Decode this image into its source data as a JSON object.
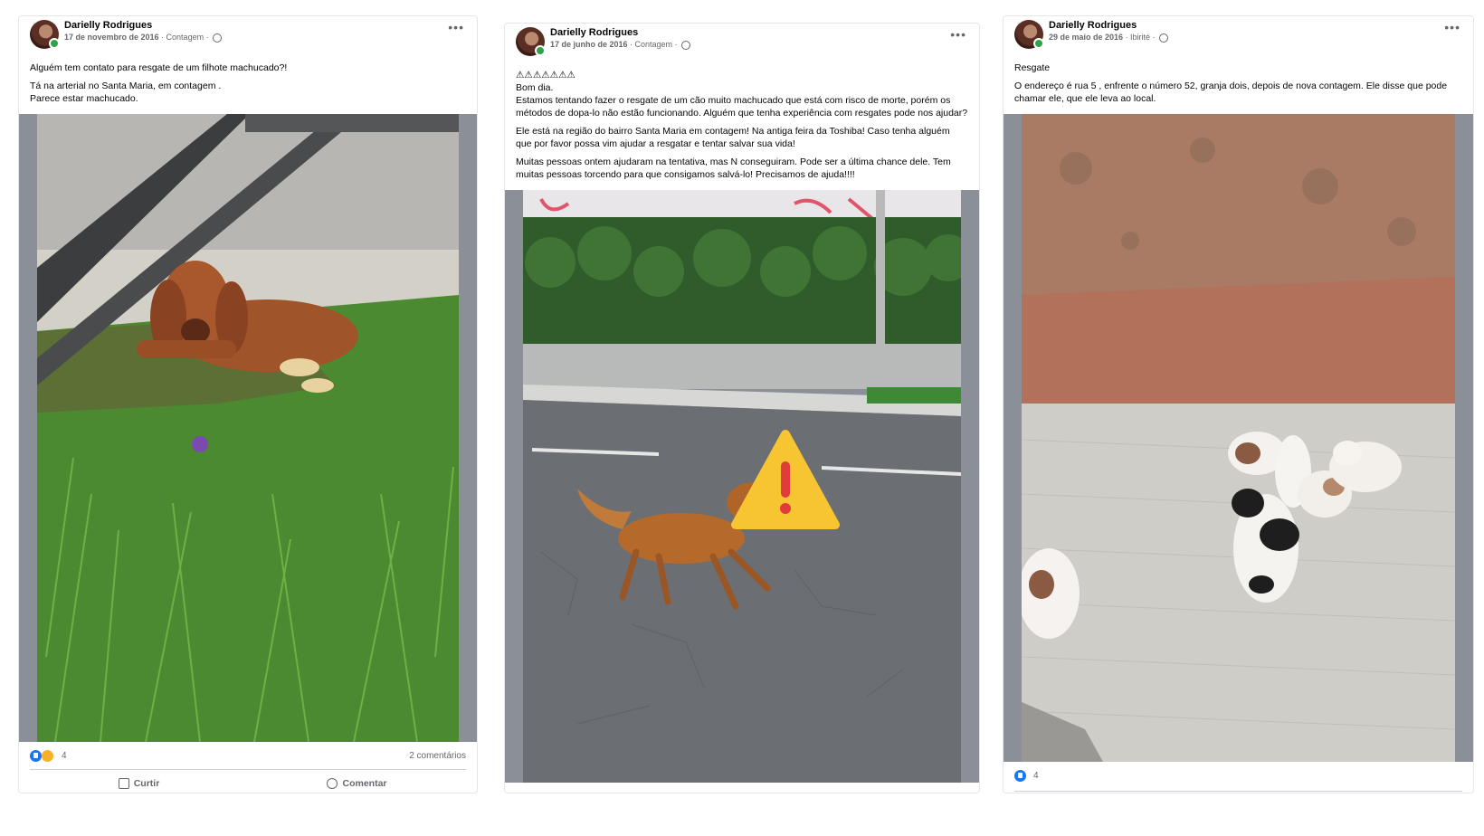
{
  "posts": [
    {
      "author": "Darielly Rodrigues",
      "date": "17 de novembro de 2016",
      "place": "Contagem",
      "text": [
        "Alguém tem contato para resgate de um filhote machucado?!",
        "Tá na arterial no Santa Maria, em contagem .\nParece estar machucado."
      ],
      "reactions_count": "4",
      "comments": "2 comentários",
      "like_label": "Curtir",
      "comment_label": "Comentar"
    },
    {
      "author": "Darielly Rodrigues",
      "date": "17 de junho de 2016",
      "place": "Contagem",
      "text": [
        "⚠⚠⚠⚠⚠⚠⚠\nBom dia.\nEstamos tentando fazer o resgate de um cão muito machucado que está com risco de morte, porém os métodos de dopa-lo não estão funcionando. Alguém que tenha experiência com resgates pode nos ajudar?",
        "Ele está na região do bairro Santa Maria em contagem! Na antiga feira da Toshiba! Caso tenha alguém que por favor possa vim ajudar a resgatar e tentar salvar sua vida!",
        "Muitas pessoas ontem ajudaram na tentativa, mas N conseguiram. Pode ser a última chance dele. Tem muitas pessoas  torcendo para que consigamos salvá-lo! Precisamos de ajuda!!!!"
      ]
    },
    {
      "author": "Darielly Rodrigues",
      "date": "29 de maio de 2016",
      "place": "Ibirité",
      "text": [
        "Resgate",
        " O endereço é rua 5 , enfrente o número 52, granja dois, depois de nova contagem. Ele disse que pode chamar ele,  que ele leva ao local."
      ],
      "reactions_count": "4"
    }
  ]
}
